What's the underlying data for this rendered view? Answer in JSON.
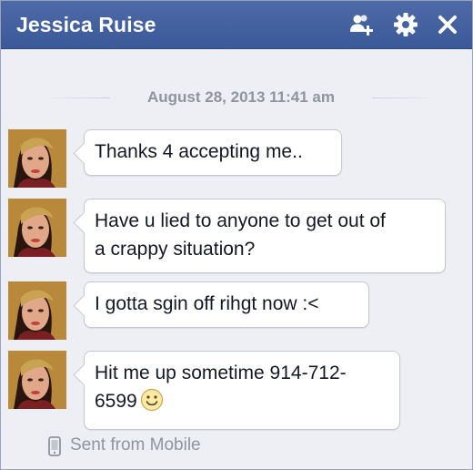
{
  "window": {
    "title": "Jessica Ruise"
  },
  "toolbar": {
    "icons": [
      "add-friend-icon",
      "gear-icon",
      "close-icon"
    ],
    "header_color": "#3b5998"
  },
  "conversation": {
    "date_divider": "August 28, 2013 11:41 am",
    "messages": [
      {
        "text": "Thanks 4 accepting me.."
      },
      {
        "text": "Have u lied to anyone to get out of\na crappy situation?"
      },
      {
        "text": "I gotta sgin off rihgt now :<"
      },
      {
        "text": "Hit me up sometime 914-712-\n6599",
        "emoji": "smiley-icon"
      }
    ],
    "footer": {
      "icon": "mobile-phone-icon",
      "label": "Sent from Mobile"
    }
  }
}
